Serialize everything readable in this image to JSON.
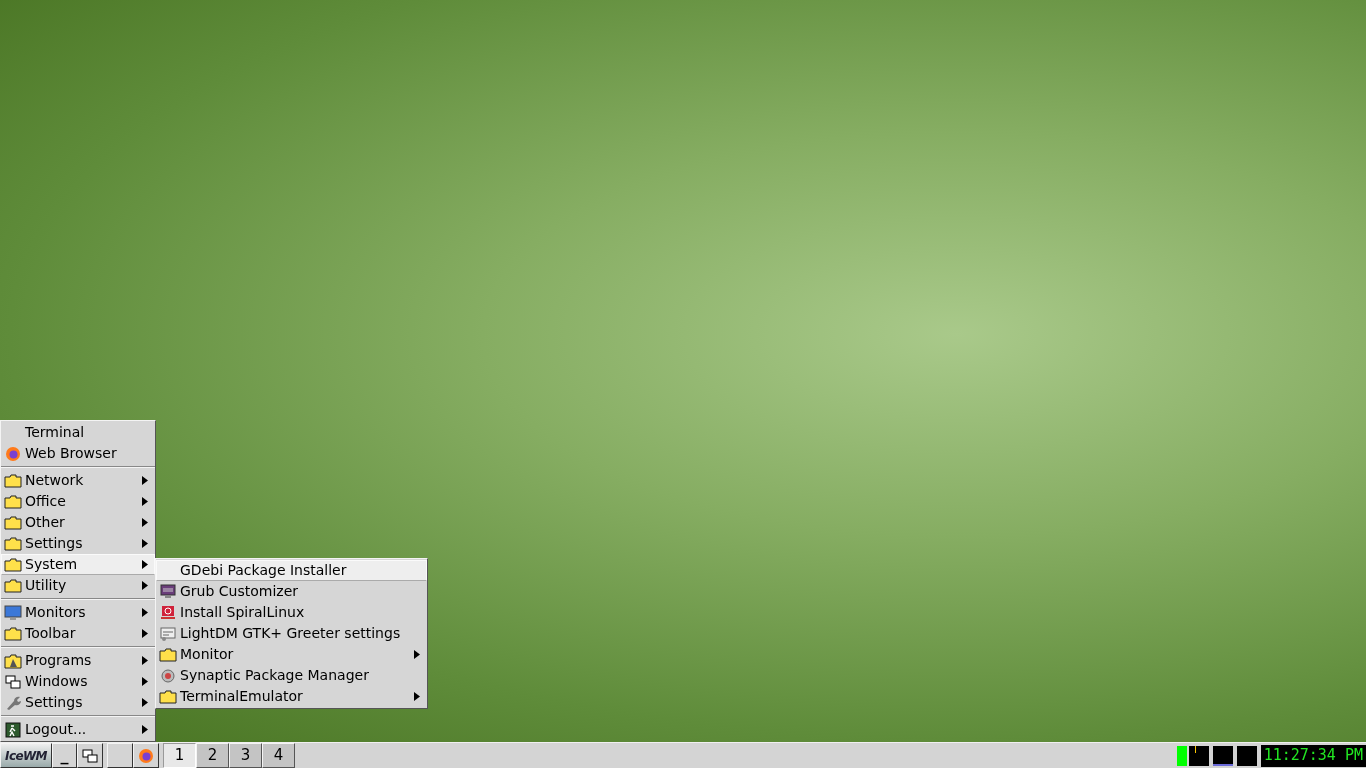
{
  "menu": {
    "items": [
      {
        "kind": "entry",
        "label": "Terminal",
        "selected": false
      },
      {
        "kind": "entry",
        "label": "Web Browser",
        "selected": false
      },
      {
        "kind": "separator"
      },
      {
        "kind": "submenu",
        "label": "Network",
        "selected": false
      },
      {
        "kind": "submenu",
        "label": "Office",
        "selected": false
      },
      {
        "kind": "submenu",
        "label": "Other",
        "selected": false
      },
      {
        "kind": "submenu",
        "label": "Settings",
        "selected": false
      },
      {
        "kind": "submenu",
        "label": "System",
        "selected": true
      },
      {
        "kind": "submenu",
        "label": "Utility",
        "selected": false
      },
      {
        "kind": "separator"
      },
      {
        "kind": "submenu",
        "label": "Monitors",
        "selected": false
      },
      {
        "kind": "submenu",
        "label": "Toolbar",
        "selected": false
      },
      {
        "kind": "separator"
      },
      {
        "kind": "submenu",
        "label": "Programs",
        "selected": false
      },
      {
        "kind": "submenu",
        "label": "Windows",
        "selected": false
      },
      {
        "kind": "submenu",
        "label": "Settings",
        "selected": false
      },
      {
        "kind": "separator"
      },
      {
        "kind": "submenu",
        "label": "Logout...",
        "selected": false
      }
    ]
  },
  "submenu": {
    "items": [
      {
        "kind": "entry",
        "label": "GDebi Package Installer",
        "selected": true
      },
      {
        "kind": "entry",
        "label": "Grub Customizer",
        "selected": false
      },
      {
        "kind": "entry",
        "label": "Install SpiralLinux",
        "selected": false
      },
      {
        "kind": "entry",
        "label": "LightDM GTK+ Greeter settings",
        "selected": false
      },
      {
        "kind": "submenu",
        "label": "Monitor",
        "selected": false
      },
      {
        "kind": "entry",
        "label": "Synaptic Package Manager",
        "selected": false
      },
      {
        "kind": "submenu",
        "label": "TerminalEmulator",
        "selected": false
      }
    ]
  },
  "taskbar": {
    "start_label": "IceWM",
    "show_desktop": "_",
    "workspaces": [
      {
        "label": "1",
        "selected": true
      },
      {
        "label": "2",
        "selected": false
      },
      {
        "label": "3",
        "selected": false
      },
      {
        "label": "4",
        "selected": false
      }
    ],
    "clock": "11:27:34 PM"
  }
}
